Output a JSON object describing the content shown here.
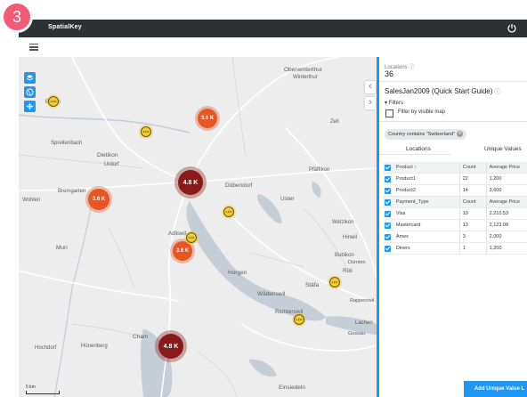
{
  "step_badge": "3",
  "app": {
    "title": "SpatialKey",
    "power_icon": "power-icon"
  },
  "map": {
    "clusters": [
      {
        "label": "3.6 K",
        "size": "mid"
      },
      {
        "label": "3.6 K",
        "size": "mid"
      },
      {
        "label": "4.8 K",
        "size": "big"
      },
      {
        "label": "3.6 K",
        "size": "mid"
      },
      {
        "label": "4.8 K",
        "size": "big"
      },
      {
        "label": "1.2 K",
        "size": "small"
      },
      {
        "label": "1.2 K",
        "size": "small"
      },
      {
        "label": "1.2 K",
        "size": "small"
      },
      {
        "label": "1.2 K",
        "size": "small"
      },
      {
        "label": "1.2 K",
        "size": "small"
      },
      {
        "label": "1.2 K",
        "size": "small"
      }
    ],
    "place_labels": {
      "oberwinterthur": "Oberwinterthur",
      "winterthur": "Winterthur",
      "dubendorf": "Dübendorf",
      "uster": "Uster",
      "dietikon": "Dietikon",
      "urdorf": "Urdorf",
      "adliswil": "Adliswil",
      "horgen": "Horgen",
      "wadenswil": "Wädenswil",
      "richterswil": "Richterswil",
      "stafa": "Stäfa",
      "cham": "Cham",
      "hunenberg": "Hünenberg",
      "einsiedeln": "Einsiedeln",
      "muri": "Muri",
      "wetzikon": "Wetzikon",
      "hinwil": "Hinwil",
      "rueti": "Rüti",
      "pfaffikon": "Pfäffikon",
      "zell": "Zell",
      "wohlen": "Wohlen",
      "bremgarten": "Bremgarten",
      "spreitenbach": "Spreitenbach",
      "baden": "Baden",
      "rapperswil": "Rapperswil",
      "lachen": "Lachen",
      "bubikon": "Bubikon",
      "durnten": "Dürnten",
      "hochdorf": "Hochdorf",
      "gossau": "Gossau"
    },
    "scale": "5 km"
  },
  "panel": {
    "locations_label": "Locations",
    "locations_count": "36",
    "dataset_name": "SalesJan2009 (Quick Start Guide)",
    "filters_label": "Filters",
    "filter_visible_map": "Filter by visible map",
    "filter_chip": "Country contains \"Switzerland\"",
    "tabs": [
      "Locations",
      "Unique Values"
    ],
    "table": [
      {
        "header": true,
        "name": "Product ↑",
        "count": "Count",
        "avg": "Average Price"
      },
      {
        "header": false,
        "name": "Product1",
        "count": "22",
        "avg": "1,200"
      },
      {
        "header": false,
        "name": "Product2",
        "count": "14",
        "avg": "3,600"
      },
      {
        "header": true,
        "name": "Payment_Type",
        "count": "Count",
        "avg": "Average Price"
      },
      {
        "header": false,
        "name": "Visa",
        "count": "19",
        "avg": "2,210.53"
      },
      {
        "header": false,
        "name": "Mastercard",
        "count": "13",
        "avg": "2,123.08"
      },
      {
        "header": false,
        "name": "Amex",
        "count": "3",
        "avg": "2,000"
      },
      {
        "header": false,
        "name": "Diners",
        "count": "1",
        "avg": "1,200"
      }
    ],
    "add_button": "Add Unique Value L"
  },
  "colors": {
    "accent": "#2196f3",
    "topbar": "#2c3134",
    "cluster_big": "#8a1a1a",
    "cluster_mid": "#e65522",
    "cluster_small": "#f0c93b"
  }
}
